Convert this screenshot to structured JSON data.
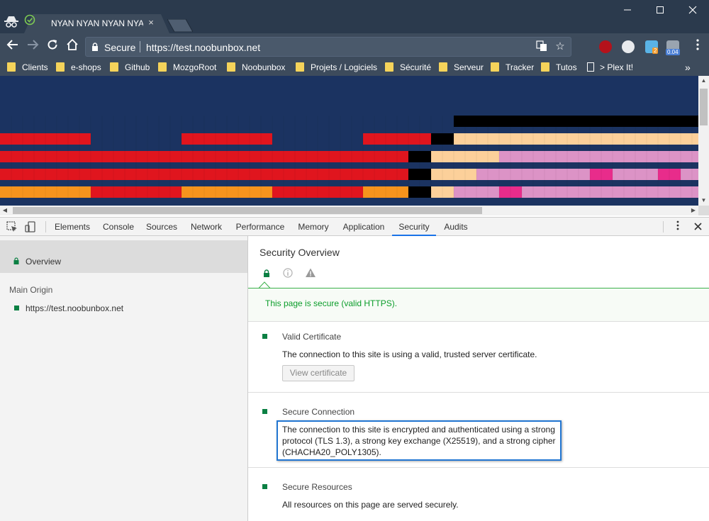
{
  "browser": {
    "tab_title": "NYAN NYAN NYAN NYAN",
    "tab_close": "×",
    "omnibox": {
      "secure_label": "Secure",
      "url": "https://test.noobunbox.net"
    },
    "extension_badges": [
      "2",
      "0.04"
    ],
    "bookmarks": [
      {
        "label": "Clients",
        "icon": "folder-icon"
      },
      {
        "label": "e-shops",
        "icon": "folder-icon"
      },
      {
        "label": "Github",
        "icon": "folder-icon"
      },
      {
        "label": "MozgoRoot",
        "icon": "folder-icon"
      },
      {
        "label": "Noobunbox",
        "icon": "folder-icon"
      },
      {
        "label": "Projets / Logiciels",
        "icon": "folder-icon"
      },
      {
        "label": "Sécurité",
        "icon": "folder-icon"
      },
      {
        "label": "Serveur",
        "icon": "folder-icon"
      },
      {
        "label": "Tracker",
        "icon": "folder-icon"
      },
      {
        "label": "Tutos",
        "icon": "folder-icon"
      },
      {
        "label": "> Plex It!",
        "icon": "page-icon"
      }
    ],
    "bookmarks_overflow": "»"
  },
  "devtools": {
    "tabs": [
      "Elements",
      "Console",
      "Sources",
      "Network",
      "Performance",
      "Memory",
      "Application",
      "Security",
      "Audits"
    ],
    "active_tab": "Security",
    "sidebar": {
      "overview_label": "Overview",
      "main_origin_heading": "Main Origin",
      "origin_url": "https://test.noobunbox.net"
    },
    "security": {
      "title": "Security Overview",
      "summary": "This page is secure (valid HTTPS).",
      "sections": [
        {
          "title": "Valid Certificate",
          "description": "The connection to this site is using a valid, trusted server certificate.",
          "button": "View certificate"
        },
        {
          "title": "Secure Connection",
          "description_lines": [
            "The connection to this site is encrypted and authenticated using a strong",
            "protocol (TLS 1.3), a strong key exchange (X25519), and a strong cipher",
            "(CHACHA20_POLY1305)."
          ]
        },
        {
          "title": "Secure Resources",
          "description": "All resources on this page are served securely."
        }
      ]
    }
  },
  "colors": {
    "secure_green": "#0b8043",
    "summary_green": "#0b9d2a",
    "highlight_blue": "#2276d2",
    "page_background": "#1b3361"
  }
}
